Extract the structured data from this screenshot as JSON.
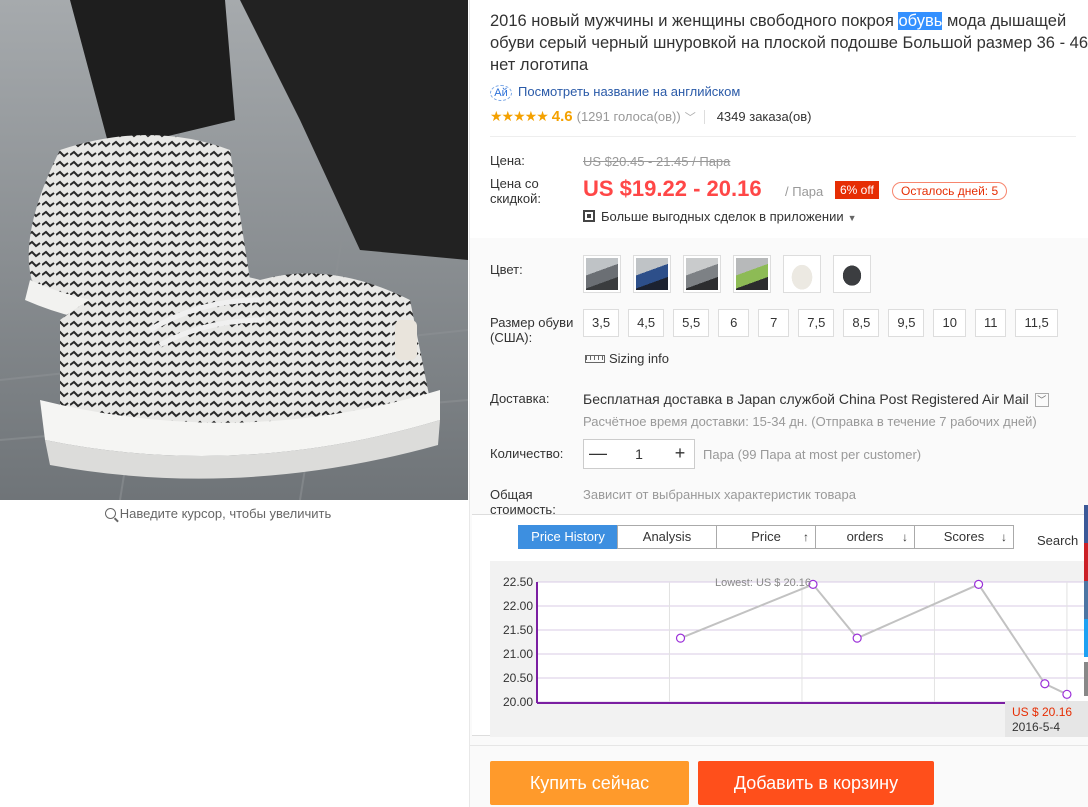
{
  "product": {
    "title_before": "2016 новый мужчины и женщины свободного покроя ",
    "title_highlight": "обувь",
    "title_after": " мода дышащей обуви серый черный шнуровкой на плоской подошве Большой размер 36 - 46 нет логотипа",
    "translate_link": "Посмотреть название на английском",
    "stars": "★★★★★",
    "rating": "4.6",
    "votes": "(1291 голоса(ов))",
    "orders": "4349 заказа(ов)",
    "zoom_hint": "Наведите курсор, чтобы увеличить"
  },
  "price": {
    "label": "Цена:",
    "old": "US $20.45 - 21.45 / Пара",
    "discount_label": "Цена со скидкой:",
    "new": "US $19.22 - 20.16",
    "per": "/ Пара",
    "discount_badge": "6% off",
    "days_left": "Осталось дней: 5",
    "app_deals": "Больше выгодных сделок в приложении"
  },
  "options": {
    "color_label": "Цвет:",
    "swatch_colors": [
      "#6b6f74",
      "#2d4f8a",
      "#7d8185",
      "#8dbb55",
      "#ece9e2",
      "#3b3d40"
    ],
    "size_label": "Размер обуви (США):",
    "sizes": [
      "3,5",
      "4,5",
      "5,5",
      "6",
      "7",
      "7,5",
      "8,5",
      "9,5",
      "10",
      "11",
      "11,5"
    ],
    "sizing_info": "Sizing info",
    "shipping_label": "Доставка:",
    "shipping_main": "Бесплатная доставка в Japan службой China Post Registered Air Mail",
    "shipping_sub": "Расчётное время доставки: 15-34 дн. (Отправка в течение 7 рабочих дней)",
    "qty_label": "Количество:",
    "qty_value": "1",
    "qty_minus": "—",
    "qty_plus": "+",
    "qty_note": "Пара (99 Пара at most per customer)",
    "total_label": "Общая стоимость:",
    "total_note": "Зависит от выбранных характеристик товара"
  },
  "price_history": {
    "tabs": [
      {
        "label": "Price History",
        "arrow": ""
      },
      {
        "label": "Analysis",
        "arrow": ""
      },
      {
        "label": "Price",
        "arrow": "↑"
      },
      {
        "label": "orders",
        "arrow": "↓"
      },
      {
        "label": "Scores",
        "arrow": "↓"
      }
    ],
    "search": "Search",
    "lowest_note": "Lowest:  US $ 20.16",
    "current_price": "US $ 20.16",
    "current_date": "2016-5-4"
  },
  "chart_data": {
    "type": "line",
    "ylim": [
      20.0,
      22.5
    ],
    "yticks": [
      "22.50",
      "22.00",
      "21.50",
      "21.00",
      "20.50",
      "20.00"
    ],
    "x_positions": [
      0.26,
      0.5,
      0.58,
      0.8,
      0.92,
      0.96
    ],
    "values": [
      21.33,
      22.45,
      21.33,
      22.45,
      20.38,
      20.16
    ],
    "colors": {
      "line": "#c2c2c2",
      "point": "#9b30d9",
      "axis": "#7b1fa2"
    }
  },
  "buttons": {
    "buy": "Купить сейчас",
    "cart": "Добавить в корзину"
  }
}
